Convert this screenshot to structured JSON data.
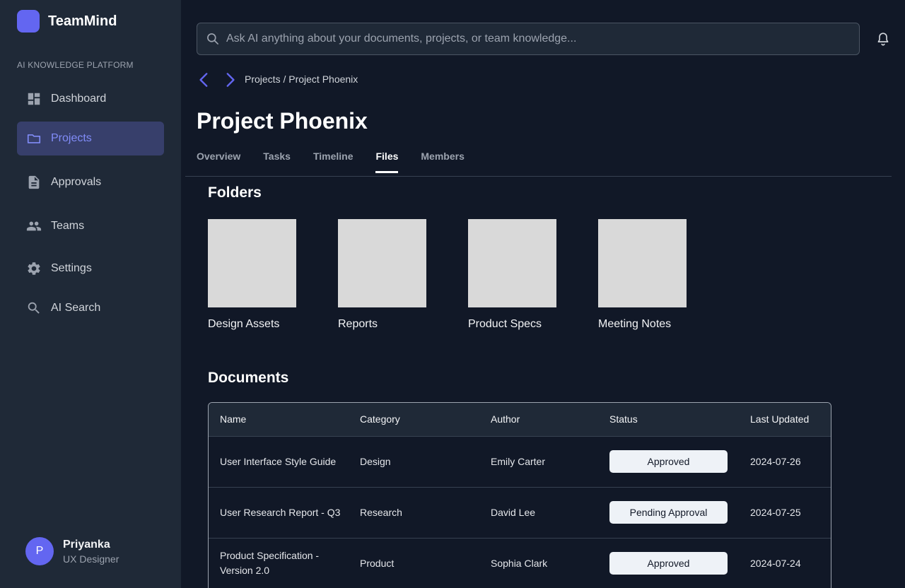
{
  "app": {
    "name": "TeamMind",
    "caption": "AI KNOWLEDGE PLATFORM",
    "accent": "#6366f1"
  },
  "sidebar": {
    "items": [
      {
        "label": "Dashboard",
        "icon": "dashboard-icon",
        "active": false
      },
      {
        "label": "Projects",
        "icon": "folder-icon",
        "active": true
      },
      {
        "label": "Approvals",
        "icon": "document-icon",
        "active": false
      },
      {
        "label": "Teams",
        "icon": "people-icon",
        "active": false
      },
      {
        "label": "Settings",
        "icon": "gear-icon",
        "active": false
      },
      {
        "label": "AI Search",
        "icon": "search-icon",
        "active": false
      }
    ]
  },
  "user": {
    "initial": "P",
    "name": "Priyanka",
    "role": "UX Designer"
  },
  "search": {
    "placeholder": "Ask AI anything about your documents, projects, or team knowledge..."
  },
  "breadcrumb": "Projects / Project Phoenix",
  "page": {
    "title": "Project Phoenix"
  },
  "tabs": [
    {
      "label": "Overview",
      "active": false
    },
    {
      "label": "Tasks",
      "active": false
    },
    {
      "label": "Timeline",
      "active": false
    },
    {
      "label": "Files",
      "active": true
    },
    {
      "label": "Members",
      "active": false
    }
  ],
  "folders": {
    "title": "Folders",
    "items": [
      {
        "name": "Design Assets"
      },
      {
        "name": "Reports"
      },
      {
        "name": "Product Specs"
      },
      {
        "name": "Meeting Notes"
      }
    ]
  },
  "documents": {
    "title": "Documents",
    "columns": [
      "Name",
      "Category",
      "Author",
      "Status",
      "Last Updated"
    ],
    "rows": [
      {
        "name": "User Interface Style Guide",
        "category": "Design",
        "author": "Emily Carter",
        "status": "Approved",
        "updated": "2024-07-26"
      },
      {
        "name": "User Research Report - Q3",
        "category": "Research",
        "author": "David Lee",
        "status": "Pending Approval",
        "updated": "2024-07-25"
      },
      {
        "name": "Product Specification - Version 2.0",
        "category": "Product",
        "author": "Sophia Clark",
        "status": "Approved",
        "updated": "2024-07-24"
      }
    ]
  }
}
